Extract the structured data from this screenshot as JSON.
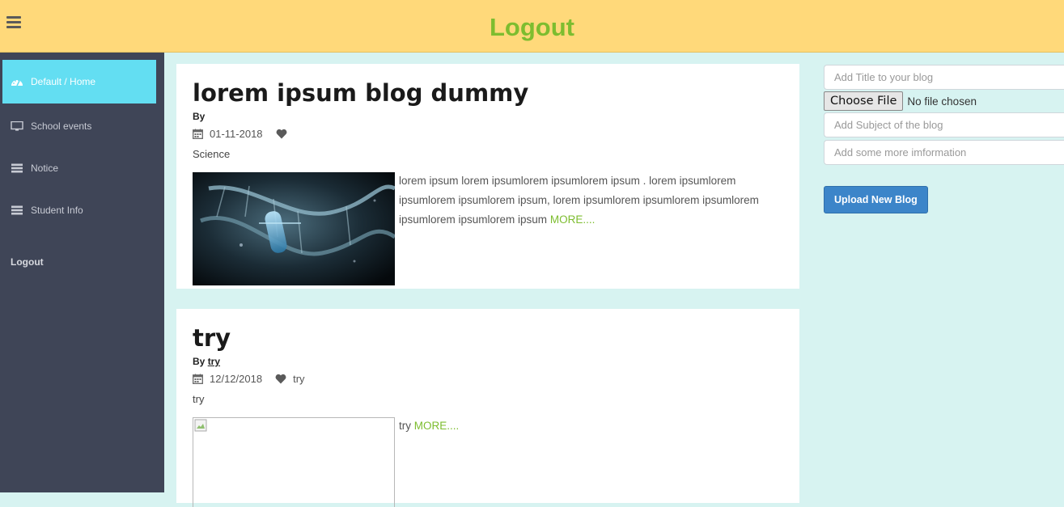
{
  "header": {
    "title": "Logout",
    "menu_icon": "hamburger-menu-icon"
  },
  "sidebar": {
    "items": [
      {
        "label": "Default / Home",
        "icon": "dashboard-icon",
        "active": true
      },
      {
        "label": "School events",
        "icon": "monitor-icon",
        "active": false
      },
      {
        "label": "Notice",
        "icon": "list-icon",
        "active": false
      },
      {
        "label": "Student Info",
        "icon": "list-icon",
        "active": false
      }
    ],
    "logout": "Logout"
  },
  "posts": [
    {
      "title": "lorem ipsum blog dummy",
      "by_label": "By",
      "author": "",
      "date": "01-11-2018",
      "likes": "",
      "subject": "Science",
      "excerpt": "lorem ipsum lorem ipsumlorem ipsumlorem ipsum . lorem ipsumlorem ipsumlorem ipsumlorem ipsum, lorem ipsumlorem ipsumlorem ipsumlorem ipsumlorem ipsumlorem ipsum",
      "more": "MORE...."
    },
    {
      "title": "try",
      "by_label": "By",
      "author": "try",
      "date": "12/12/2018",
      "likes": "try",
      "subject": "try",
      "excerpt": "try",
      "more": "MORE...."
    }
  ],
  "form": {
    "title_placeholder": "Add Title to your blog",
    "file_button": "Choose File",
    "file_status": "No file chosen",
    "subject_placeholder": "Add Subject of the blog",
    "info_placeholder": "Add some more imformation",
    "upload_button": "Upload New Blog"
  },
  "colors": {
    "header_bg": "#ffd97a",
    "accent_green": "#7dbd2f",
    "sidebar_bg": "#3f4557",
    "active_item": "#63def2",
    "page_bg": "#d7f3f1",
    "button_blue": "#3c85c9"
  }
}
